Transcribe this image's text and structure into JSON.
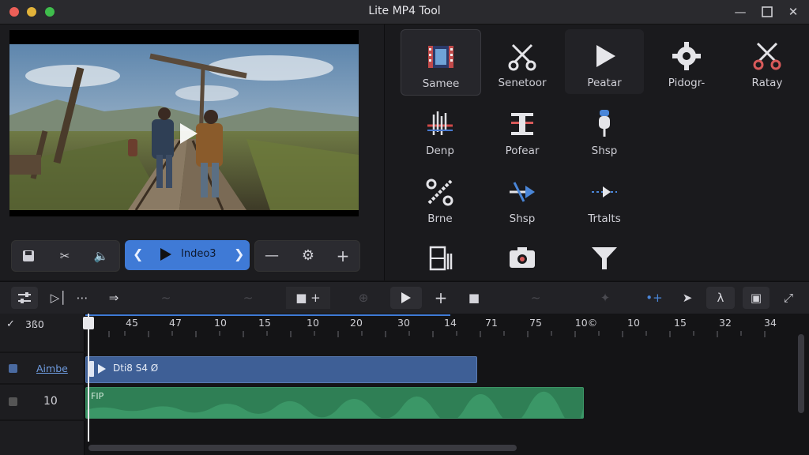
{
  "window": {
    "title": "Lite MP4 Tool"
  },
  "preview": {
    "action": "play"
  },
  "playback": {
    "label": "Indeo3"
  },
  "tools": [
    {
      "label": "Samee",
      "icon": "film-strip-icon"
    },
    {
      "label": "Senetoor",
      "icon": "scissors-icon"
    },
    {
      "label": "Peatar",
      "icon": "play-icon"
    },
    {
      "label": "Pidogr-",
      "icon": "gear-icon"
    },
    {
      "label": "Ratay",
      "icon": "scissors-red-icon"
    },
    {
      "label": "Denp",
      "icon": "waveform-icon"
    },
    {
      "label": "Pofear",
      "icon": "align-icon"
    },
    {
      "label": "Shsp",
      "icon": "microphone-icon"
    },
    {
      "label": "Brne",
      "icon": "cut-tool-icon"
    },
    {
      "label": "Shsp",
      "icon": "arrow-split-icon"
    },
    {
      "label": "Trtalts",
      "icon": "transition-icon"
    },
    {
      "label": "",
      "icon": "trim-icon"
    },
    {
      "label": "",
      "icon": "camera-icon"
    },
    {
      "label": "",
      "icon": "filter-icon"
    }
  ],
  "timeline": {
    "header_label": "3ß0",
    "ticks": [
      "45",
      "47",
      "10",
      "15",
      "10",
      "20",
      "30",
      "14",
      "71",
      "75",
      "10©",
      "10",
      "15",
      "32",
      "34"
    ],
    "tracks": [
      {
        "name": "Aimbe",
        "clip_label": "Dti8 S4 Ø"
      },
      {
        "name": "10",
        "clip_label": "FIP"
      }
    ]
  },
  "colors": {
    "accent": "#3f7ad6",
    "video_clip": "#3e5f96",
    "audio_clip": "#2f7f55"
  }
}
